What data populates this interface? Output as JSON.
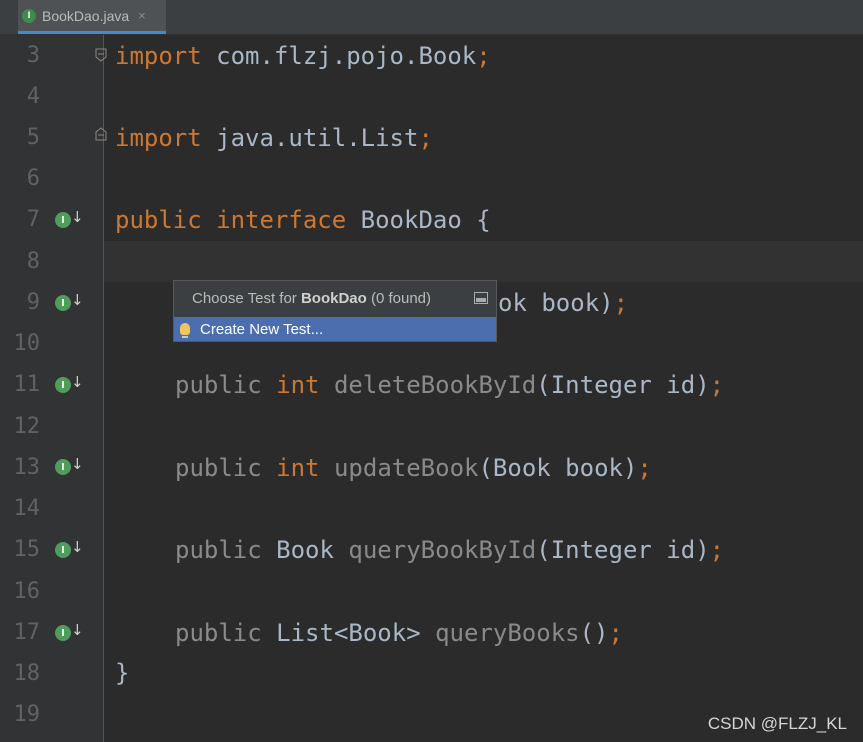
{
  "tab": {
    "icon": "I",
    "label": "BookDao.java",
    "close": "×"
  },
  "line_numbers": [
    "3",
    "4",
    "5",
    "6",
    "7",
    "8",
    "9",
    "10",
    "11",
    "12",
    "13",
    "14",
    "15",
    "16",
    "17",
    "18",
    "19"
  ],
  "code": {
    "l3": {
      "kw": "import",
      "rest": " com.flzj.pojo.Book",
      "semi": ";"
    },
    "l5": {
      "kw": "import",
      "rest": " java.util.List",
      "semi": ";"
    },
    "l7": {
      "kw1": "public",
      "kw2": "interface",
      "rest": " BookDao {"
    },
    "l9": {
      "rest": "ok book)",
      "semi": ";"
    },
    "l11": {
      "mod": "public",
      "type": "int",
      "name": "deleteBookById",
      "args": "(Integer id)",
      "semi": ";"
    },
    "l13": {
      "mod": "public",
      "type": "int",
      "name": "updateBook",
      "args": "(Book book)",
      "semi": ";"
    },
    "l15": {
      "mod": "public",
      "type": "Book",
      "name": "queryBookById",
      "args": "(Integer id)",
      "semi": ";"
    },
    "l17": {
      "mod": "public",
      "type": "List<Book>",
      "name": "queryBooks",
      "args": "()",
      "semi": ";"
    },
    "l18": {
      "rest": "}"
    }
  },
  "popup": {
    "prefix": "Choose Test for ",
    "class_name": "BookDao",
    "suffix": " (0 found)",
    "item": "Create New Test..."
  },
  "gutter_icon_label": "I",
  "gutter_arrow": "↓",
  "watermark": "CSDN @FLZJ_KL",
  "colors": {
    "keyword": "#cc7832",
    "text": "#a9b7c6",
    "selection": "#4b6eaf",
    "background": "#2b2b2b"
  }
}
